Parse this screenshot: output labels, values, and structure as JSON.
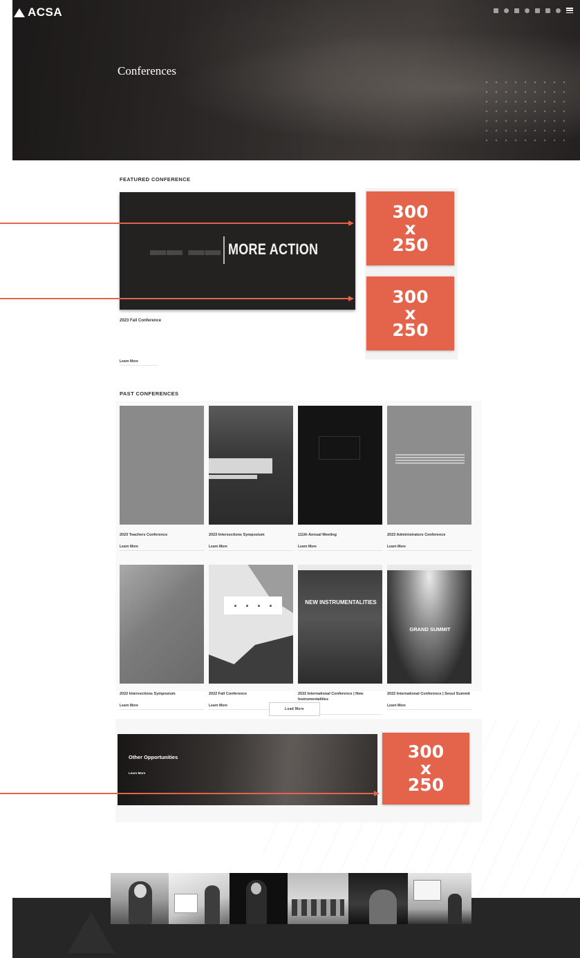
{
  "header": {
    "logo_text": "ACSA",
    "nav": [
      "",
      "",
      "",
      "",
      "",
      ""
    ],
    "breadcrumb": [
      "",
      "",
      ""
    ]
  },
  "hero": {
    "title": "Conferences",
    "description": ""
  },
  "featured": {
    "heading": "FEATURED CONFERENCE",
    "image_title": "MORE ACTION",
    "name": "2023 Fall Conference",
    "learn_more": "Learn More"
  },
  "ads": [
    {
      "w": "300",
      "x": "x",
      "h": "250"
    },
    {
      "w": "300",
      "x": "x",
      "h": "250"
    },
    {
      "w": "300",
      "x": "x",
      "h": "250"
    }
  ],
  "past": {
    "heading": "PAST CONFERENCES",
    "cards": [
      {
        "title": "2023 Teachers Conference",
        "link": "Learn More"
      },
      {
        "title": "2023 Intersections Symposium",
        "link": "Learn More"
      },
      {
        "title": "111th Annual Meeting",
        "link": "Learn More"
      },
      {
        "title": "2023 Administrators Conference",
        "link": "Learn More"
      },
      {
        "title": "2022 Intersections Symposium",
        "link": "Learn More"
      },
      {
        "title": "2022 Fall Conference",
        "link": "Learn More"
      },
      {
        "title": "2022 International Conference | New Instrumentalities",
        "link": "Learn More",
        "image_text": "NEW INSTRUMENTALITIES"
      },
      {
        "title": "2022 International Conference | Seoul Summit",
        "link": "Learn More",
        "image_text": "GRAND SUMMIT"
      }
    ],
    "load_more": "Load More"
  },
  "opportunities": {
    "title": "Other Opportunities",
    "description": "",
    "link": "Learn More"
  },
  "colors": {
    "accent": "#e3644a",
    "hero_bg": "#2b2827",
    "footer_bg": "#262626"
  }
}
